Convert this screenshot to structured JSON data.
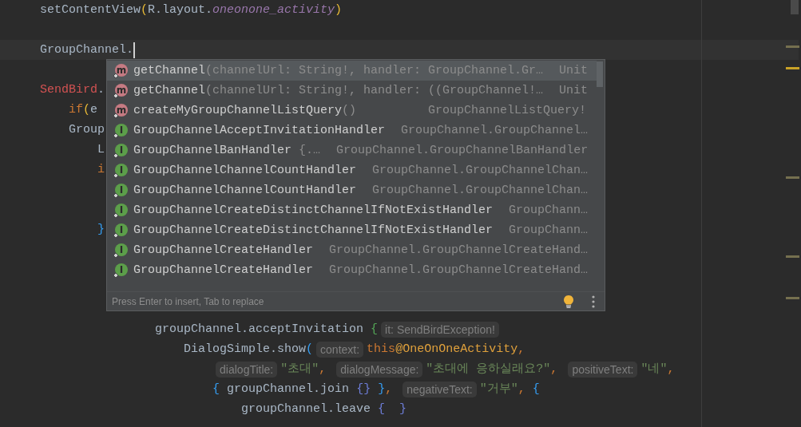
{
  "editor": {
    "lines": [
      {
        "kind": "code",
        "current": false,
        "tokens": [
          {
            "text": "setContentView",
            "kind": "plain"
          },
          {
            "text": "(",
            "kind": "br1"
          },
          {
            "text": "R.layout.",
            "kind": "plain"
          },
          {
            "text": "oneonone_activity",
            "kind": "field"
          },
          {
            "text": ")",
            "kind": "br1"
          }
        ]
      },
      {
        "kind": "blank"
      },
      {
        "kind": "code",
        "current": true,
        "tokens": [
          {
            "text": "GroupChannel.",
            "kind": "plain"
          }
        ]
      },
      {
        "kind": "blank"
      },
      {
        "kind": "code",
        "current": false,
        "tokens": [
          {
            "text": "SendBird",
            "kind": "error"
          },
          {
            "text": ".",
            "kind": "plain"
          }
        ]
      },
      {
        "kind": "code",
        "current": false,
        "tokens": [
          {
            "text": "    if",
            "kind": "keyword"
          },
          {
            "text": "(",
            "kind": "br1"
          },
          {
            "text": "e",
            "kind": "plain"
          }
        ]
      },
      {
        "kind": "code",
        "current": false,
        "tokens": [
          {
            "text": "    Group",
            "kind": "plain"
          }
        ]
      },
      {
        "kind": "code",
        "current": false,
        "tokens": [
          {
            "text": "        L",
            "kind": "plain"
          }
        ]
      },
      {
        "kind": "code",
        "current": false,
        "tokens": [
          {
            "text": "        i",
            "kind": "keyword"
          }
        ]
      },
      {
        "kind": "blank"
      },
      {
        "kind": "blank"
      },
      {
        "kind": "code",
        "current": false,
        "tokens": [
          {
            "text": "        }",
            "kind": "br3"
          }
        ]
      },
      {
        "kind": "blank"
      },
      {
        "kind": "blank"
      },
      {
        "kind": "blank"
      },
      {
        "kind": "blank"
      },
      {
        "kind": "code",
        "current": false,
        "tokens": [
          {
            "text": "                groupChannel.acceptInvitation ",
            "kind": "plain"
          },
          {
            "text": "{",
            "kind": "br2"
          },
          {
            "text": "it: SendBirdException!",
            "kind": "hint"
          }
        ]
      },
      {
        "kind": "code",
        "current": false,
        "tokens": [
          {
            "text": "                    DialogSimple.show",
            "kind": "plain"
          },
          {
            "text": "(",
            "kind": "br3"
          },
          {
            "text": "context:",
            "kind": "hint"
          },
          {
            "text": "this",
            "kind": "keyword"
          },
          {
            "text": "@OneOnOneActivity",
            "kind": "label"
          },
          {
            "text": ",",
            "kind": "comma"
          }
        ]
      },
      {
        "kind": "code",
        "current": false,
        "tokens": [
          {
            "text": "                        dialogTitle:",
            "kind": "hint"
          },
          {
            "text": "\"초대\"",
            "kind": "string"
          },
          {
            "text": ", ",
            "kind": "comma"
          },
          {
            "text": "dialogMessage:",
            "kind": "hint"
          },
          {
            "text": "\"초대에 응하실래요?\"",
            "kind": "string"
          },
          {
            "text": ", ",
            "kind": "comma"
          },
          {
            "text": "positiveText:",
            "kind": "hint"
          },
          {
            "text": "\"네\"",
            "kind": "string"
          },
          {
            "text": ",",
            "kind": "comma"
          }
        ]
      },
      {
        "kind": "code",
        "current": false,
        "tokens": [
          {
            "text": "                        {",
            "kind": "br3"
          },
          {
            "text": " groupChannel.join ",
            "kind": "plain"
          },
          {
            "text": "{}",
            "kind": "br4"
          },
          {
            "text": " }",
            "kind": "br3"
          },
          {
            "text": ", ",
            "kind": "comma"
          },
          {
            "text": "negativeText:",
            "kind": "hint"
          },
          {
            "text": "\"거부\"",
            "kind": "string"
          },
          {
            "text": ", ",
            "kind": "comma"
          },
          {
            "text": "{",
            "kind": "br3"
          }
        ]
      },
      {
        "kind": "code",
        "current": false,
        "tokens": [
          {
            "text": "                            groupChannel.leave ",
            "kind": "plain"
          },
          {
            "text": "{  }",
            "kind": "br4"
          }
        ]
      }
    ]
  },
  "popup": {
    "items": [
      {
        "kind": "method",
        "icon": "m",
        "name": "getChannel",
        "params": "(channelUrl: String!, handler: GroupChannel.Gr…",
        "type": "Unit",
        "selected": true
      },
      {
        "kind": "method",
        "icon": "m",
        "name": "getChannel",
        "params": "(channelUrl: String!, handler: ((GroupChannel!…",
        "type": "Unit",
        "selected": false
      },
      {
        "kind": "method",
        "icon": "m",
        "name": "createMyGroupChannelListQuery",
        "params": "()",
        "type": "GroupChannelListQuery!",
        "selected": false
      },
      {
        "kind": "interface",
        "icon": "I",
        "name": "GroupChannelAcceptInvitationHandler",
        "type": "GroupChannel.GroupChannel…",
        "selected": false
      },
      {
        "kind": "interface",
        "icon": "I",
        "name": "GroupChannelBanHandler",
        "params": " {.…",
        "type": "GroupChannel.GroupChannelBanHandler",
        "selected": false
      },
      {
        "kind": "interface",
        "icon": "I",
        "name": "GroupChannelChannelCountHandler",
        "type": "GroupChannel.GroupChannelChan…",
        "selected": false
      },
      {
        "kind": "interface",
        "icon": "I",
        "name": "GroupChannelChannelCountHandler",
        "type": "GroupChannel.GroupChannelChan…",
        "selected": false
      },
      {
        "kind": "interface",
        "icon": "I",
        "name": "GroupChannelCreateDistinctChannelIfNotExistHandler",
        "type": "GroupChann…",
        "selected": false
      },
      {
        "kind": "interface",
        "icon": "I",
        "name": "GroupChannelCreateDistinctChannelIfNotExistHandler",
        "type": "GroupChann…",
        "selected": false
      },
      {
        "kind": "interface",
        "icon": "I",
        "name": "GroupChannelCreateHandler",
        "type": "GroupChannel.GroupChannelCreateHand…",
        "selected": false
      },
      {
        "kind": "interface",
        "icon": "I",
        "name": "GroupChannelCreateHandler",
        "type": "GroupChannel.GroupChannelCreateHand…",
        "selected": false
      }
    ],
    "footer": "Press Enter to insert, Tab to replace"
  }
}
